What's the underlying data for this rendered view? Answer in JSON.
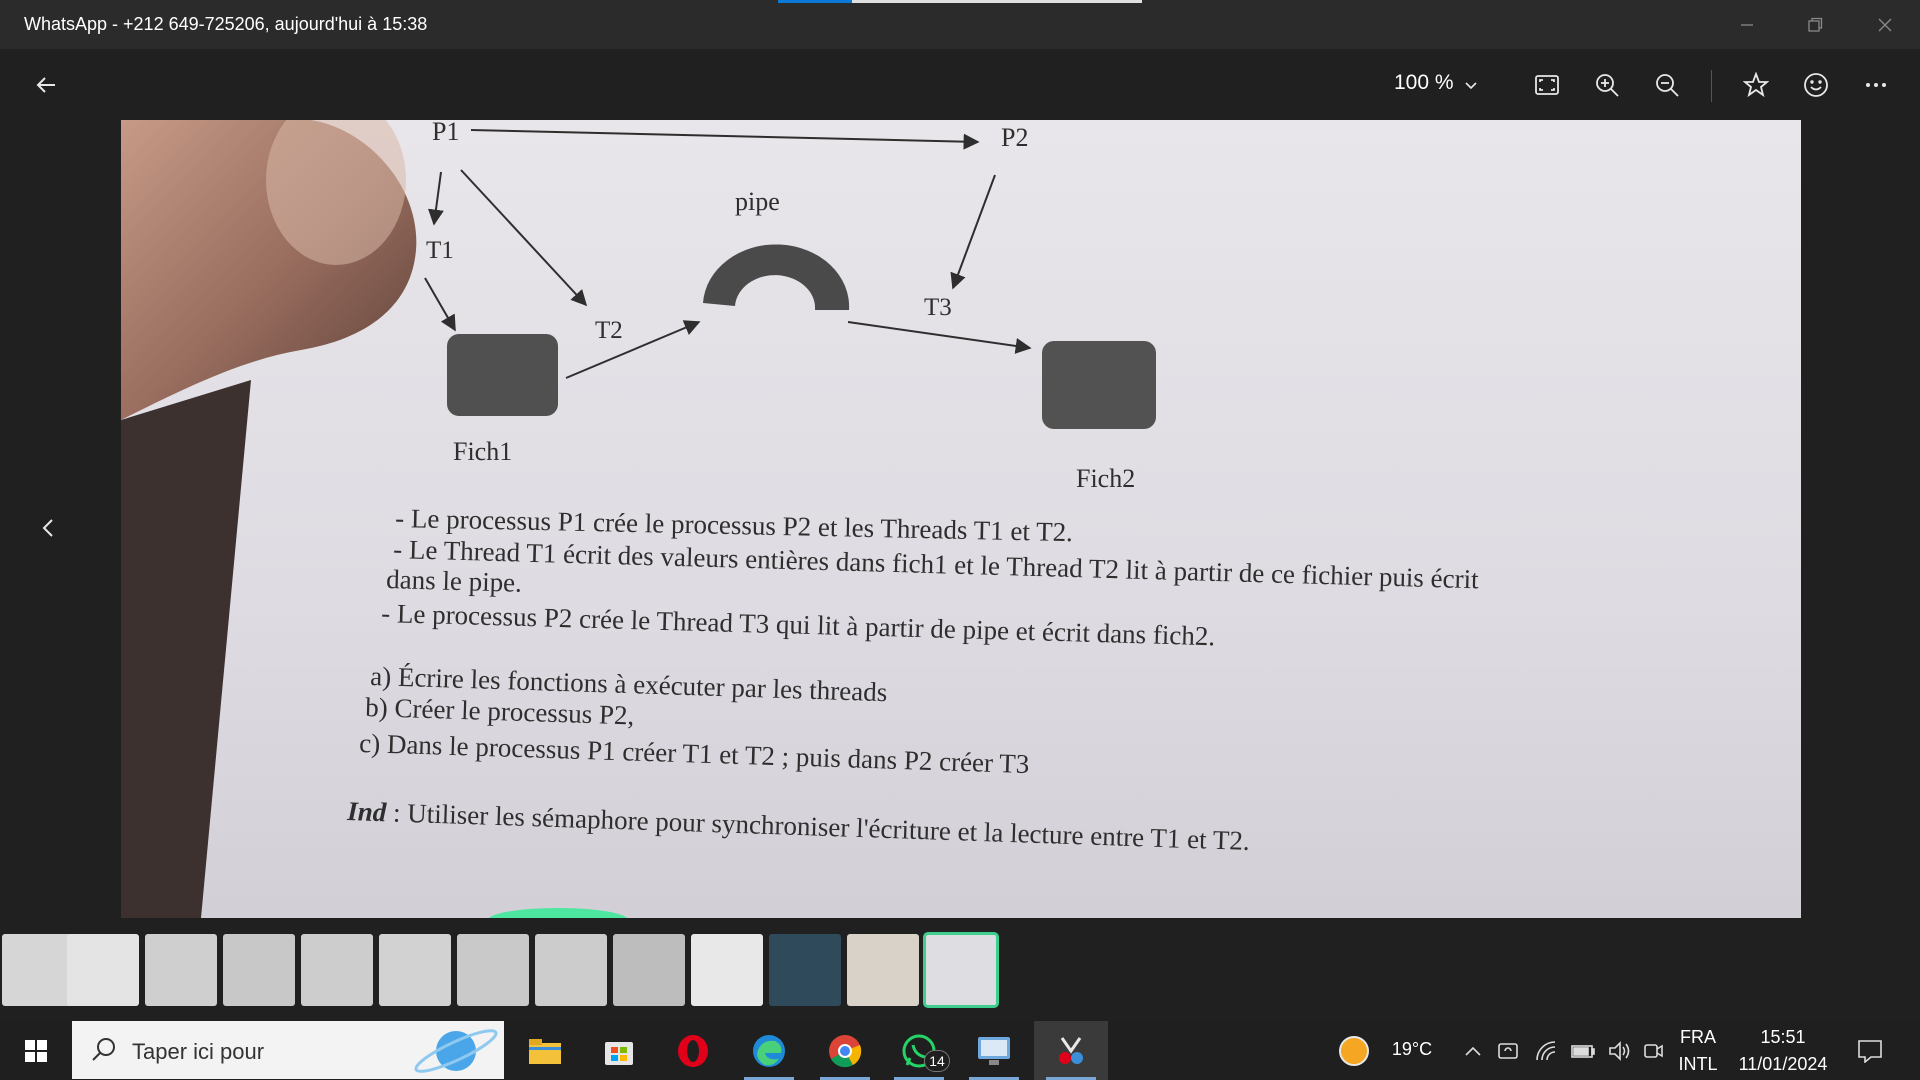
{
  "window": {
    "title": "WhatsApp - +212 649-725206, aujourd'hui à 15:38"
  },
  "toolbar": {
    "zoom_value": "100 %"
  },
  "document": {
    "labels": {
      "p1": "P1",
      "p2": "P2",
      "t1": "T1",
      "t2": "T2",
      "t3": "T3",
      "pipe": "pipe",
      "fich1": "Fich1",
      "fich2": "Fich2"
    },
    "bullets": [
      "- Le processus P1 crée le processus P2 et les Threads T1 et T2.",
      "- Le Thread T1 écrit des valeurs entières dans fich1 et le Thread T2 lit à partir de ce fichier puis écrit",
      "dans le pipe.",
      "- Le processus P2 crée le Thread T3 qui lit à partir de pipe et  écrit dans fich2."
    ],
    "questions": [
      "a) Écrire les fonctions  à exécuter par les threads",
      "b) Créer le processus P2,",
      "c) Dans le processus P1 créer T1 et T2 ; puis dans P2 créer T3"
    ],
    "hint_label": "Ind",
    "hint_text": " : Utiliser les sémaphore pour synchroniser l'écriture et la lecture entre T1 et T2."
  },
  "taskbar": {
    "search_placeholder": "Taper ici pour",
    "whatsapp_badge": "14",
    "weather_temp": "19°C",
    "lang_top": "FRA",
    "lang_bottom": "INTL",
    "time": "15:51",
    "date": "11/01/2024"
  }
}
